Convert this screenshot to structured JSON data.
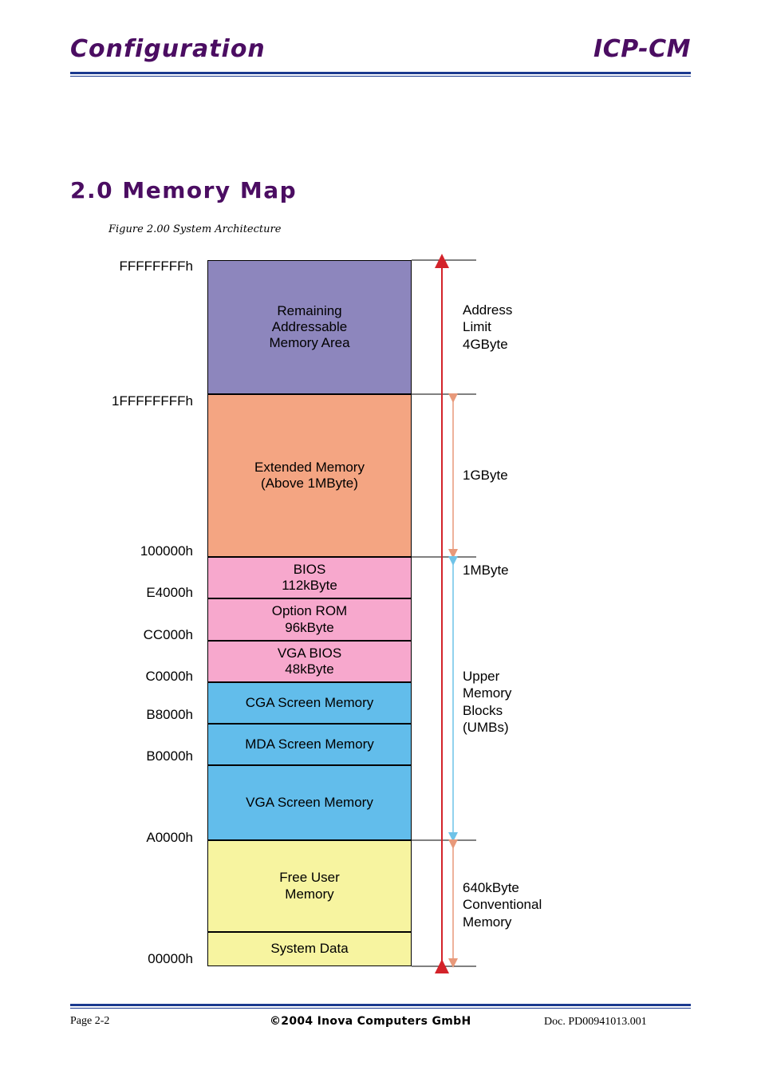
{
  "header": {
    "left_title": "Configuration",
    "right_title": "ICP-CM"
  },
  "section": {
    "title": "2.0 Memory Map",
    "figure_caption": "Figure 2.00 System Architecture"
  },
  "diagram": {
    "blocks": [
      {
        "label": "Remaining\nAddressable\nMemory Area",
        "color": "#8d86bd"
      },
      {
        "label": "Extended Memory\n(Above 1MByte)",
        "color": "#f4a582"
      },
      {
        "label": "BIOS\n112kByte",
        "color": "#f7a8cd"
      },
      {
        "label": "Option ROM\n96kByte",
        "color": "#f7a8cd"
      },
      {
        "label": "VGA BIOS\n48kByte",
        "color": "#f7a8cd"
      },
      {
        "label": "CGA Screen Memory",
        "color": "#62bdeb"
      },
      {
        "label": "MDA Screen Memory",
        "color": "#62bdeb"
      },
      {
        "label": "VGA Screen Memory",
        "color": "#62bdeb"
      },
      {
        "label": "Free User\nMemory",
        "color": "#f7f4a0"
      },
      {
        "label": "System Data",
        "color": "#f7f4a0"
      }
    ],
    "addresses": [
      "FFFFFFFFh",
      "1FFFFFFFFh",
      "100000h",
      "E4000h",
      "CC000h",
      "C0000h",
      "B8000h",
      "B0000h",
      "A0000h",
      "00000h"
    ],
    "annotations": [
      "Address\nLimit\n4GByte",
      "1GByte",
      "1MByte",
      "Upper\nMemory\nBlocks\n(UMBs)",
      "640kByte\nConventional\nMemory"
    ]
  },
  "footer": {
    "page": "Page 2-2",
    "copyright": "©2004 Inova Computers GmbH",
    "doc": "Doc. PD00941013.001"
  }
}
